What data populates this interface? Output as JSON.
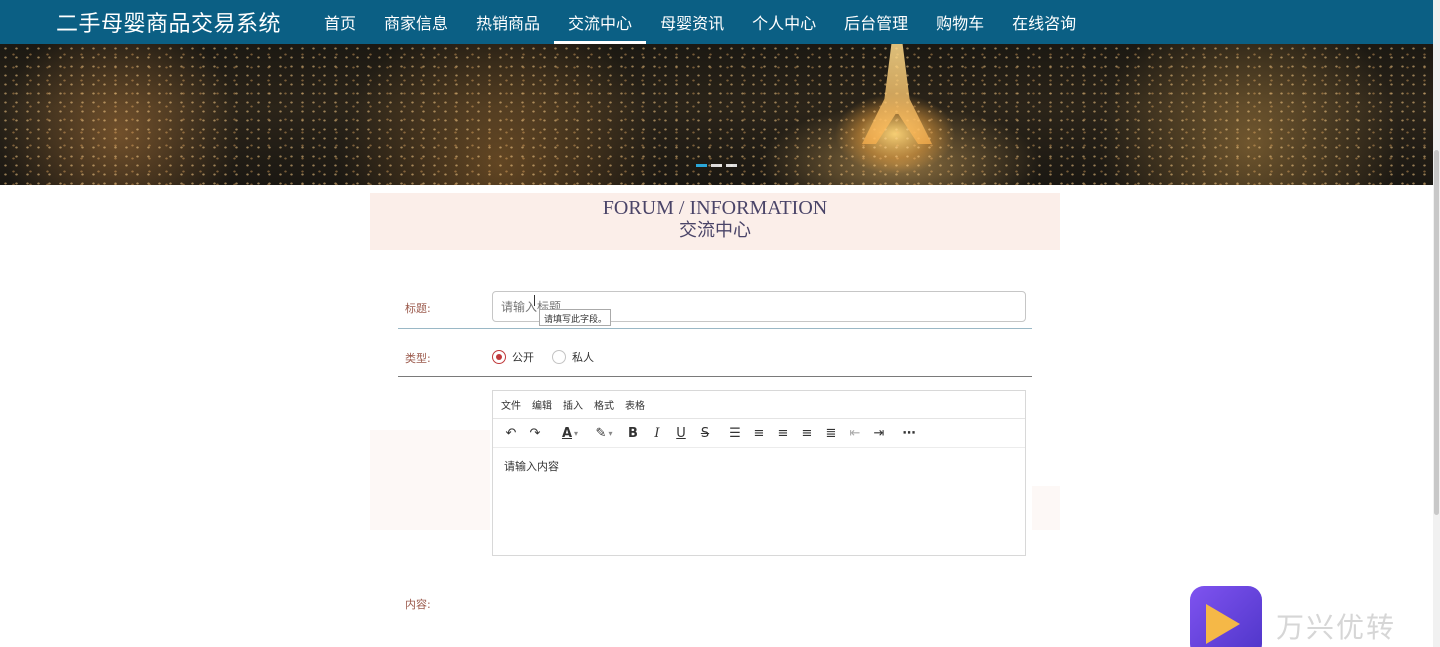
{
  "brand": "二手母婴商品交易系统",
  "nav": [
    {
      "label": "首页",
      "active": false
    },
    {
      "label": "商家信息",
      "active": false
    },
    {
      "label": "热销商品",
      "active": false
    },
    {
      "label": "交流中心",
      "active": true
    },
    {
      "label": "母婴资讯",
      "active": false
    },
    {
      "label": "个人中心",
      "active": false
    },
    {
      "label": "后台管理",
      "active": false
    },
    {
      "label": "购物车",
      "active": false
    },
    {
      "label": "在线咨询",
      "active": false
    }
  ],
  "section": {
    "title_en": "FORUM / INFORMATION",
    "title_cn": "交流中心"
  },
  "form": {
    "title_label": "标题:",
    "title_placeholder": "请输入标题",
    "tooltip": "请填写此字段。",
    "type_label": "类型:",
    "type_options": [
      {
        "label": "公开",
        "checked": true
      },
      {
        "label": "私人",
        "checked": false
      }
    ],
    "content_label": "内容:"
  },
  "editor": {
    "menu": [
      "文件",
      "编辑",
      "插入",
      "格式",
      "表格"
    ],
    "body_placeholder": "请输入内容",
    "toolbar": [
      {
        "name": "undo-icon",
        "glyph": "↶"
      },
      {
        "name": "redo-icon",
        "glyph": "↷"
      },
      {
        "name": "text-color-icon",
        "glyph": "A"
      },
      {
        "name": "highlight-icon",
        "glyph": "✎"
      },
      {
        "name": "bold-icon",
        "glyph": "B"
      },
      {
        "name": "italic-icon",
        "glyph": "I"
      },
      {
        "name": "underline-icon",
        "glyph": "U"
      },
      {
        "name": "strikethrough-icon",
        "glyph": "S"
      },
      {
        "name": "line-height-icon",
        "glyph": "☰"
      },
      {
        "name": "align-left-icon",
        "glyph": "≡"
      },
      {
        "name": "align-center-icon",
        "glyph": "≡"
      },
      {
        "name": "align-right-icon",
        "glyph": "≡"
      },
      {
        "name": "align-justify-icon",
        "glyph": "≣"
      },
      {
        "name": "outdent-icon",
        "glyph": "⇤"
      },
      {
        "name": "indent-icon",
        "glyph": "⇥"
      },
      {
        "name": "more-icon",
        "glyph": "⋯"
      }
    ]
  },
  "banner": {
    "slides": 3,
    "active_slide": 0
  },
  "watermark": {
    "text": "万兴优转"
  },
  "colors": {
    "nav_bg": "#0b5f84",
    "section_bg": "#fbeee9",
    "accent_red": "#c0393b"
  }
}
